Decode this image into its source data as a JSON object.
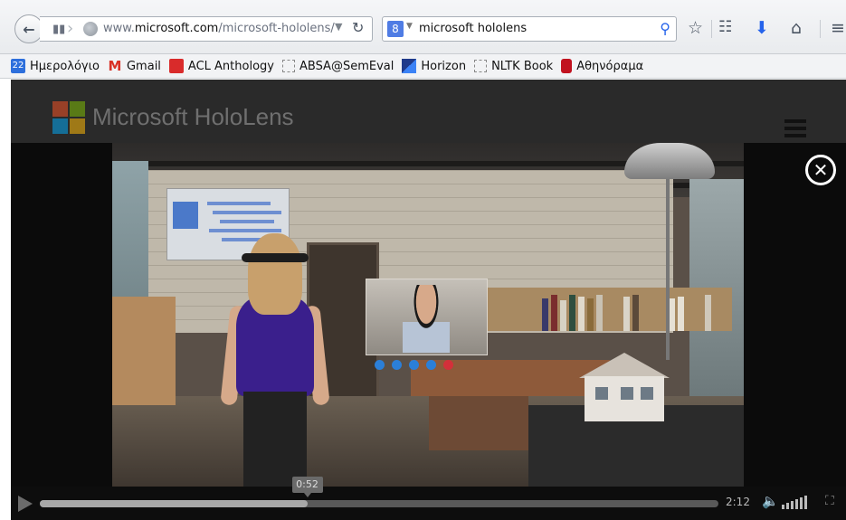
{
  "browser": {
    "url_prefix": "www.",
    "url_host": "microsoft.com",
    "url_path": "/microsoft-hololens/",
    "search_engine_badge": "8",
    "search_query": "microsoft hololens"
  },
  "bookmarks": [
    {
      "label": "Ημερολόγιο",
      "icon": "calendar-icon",
      "badge": "22"
    },
    {
      "label": "Gmail",
      "icon": "gmail-icon",
      "badge": "M"
    },
    {
      "label": "ACL Anthology",
      "icon": "acl-icon",
      "badge": ""
    },
    {
      "label": "ABSA@SemEval",
      "icon": "page-icon",
      "badge": ""
    },
    {
      "label": "Horizon",
      "icon": "horizon-icon",
      "badge": ""
    },
    {
      "label": "NLTK Book",
      "icon": "page-icon",
      "badge": ""
    },
    {
      "label": "Αθηνόραμα",
      "icon": "athinorama-icon",
      "badge": ""
    }
  ],
  "site": {
    "brand": "Microsoft HoloLens",
    "brand_colors": [
      "#f35325",
      "#81bc06",
      "#05a6f0",
      "#ffba08"
    ]
  },
  "player": {
    "current_time": "0:52",
    "duration": "2:12",
    "progress_fraction": 0.394
  }
}
